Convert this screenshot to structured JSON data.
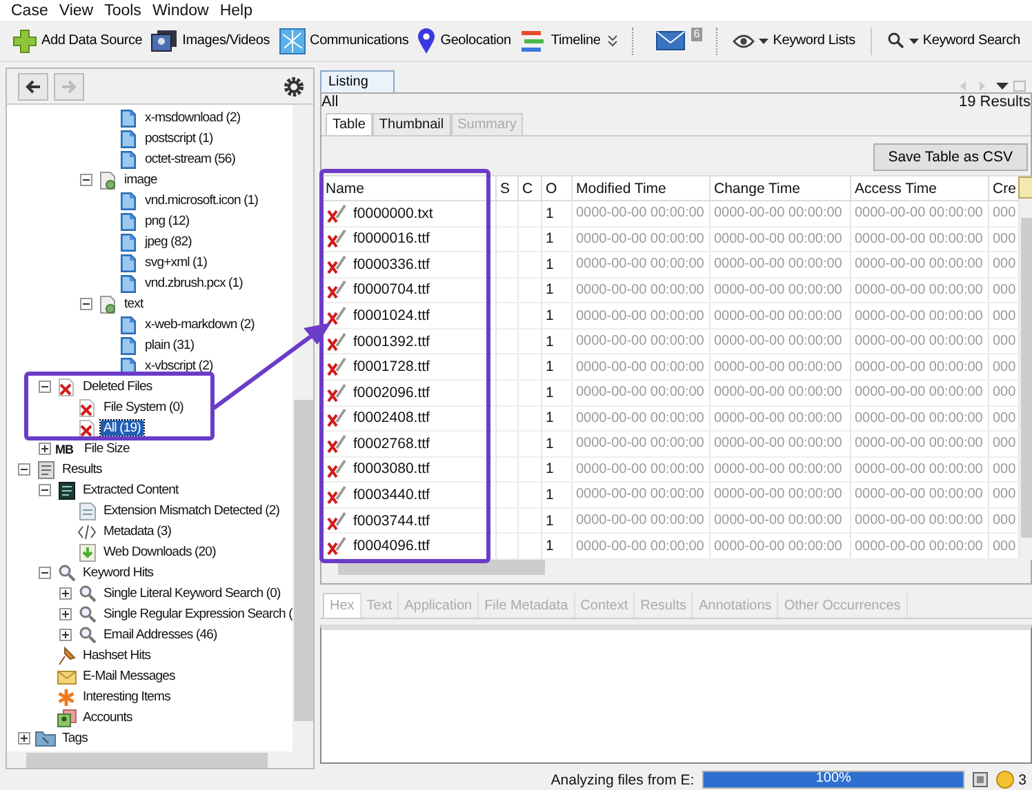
{
  "menu": [
    "Case",
    "View",
    "Tools",
    "Window",
    "Help"
  ],
  "toolbar": [
    {
      "kind": "add",
      "label": "Add Data Source"
    },
    {
      "kind": "images",
      "label": "Images/Videos"
    },
    {
      "kind": "comms",
      "label": "Communications"
    },
    {
      "kind": "geo",
      "label": "Geolocation"
    },
    {
      "kind": "timeline",
      "label": "Timeline"
    },
    {
      "kind": "more"
    },
    {
      "kind": "mail",
      "badge": "6"
    },
    {
      "kind": "eye",
      "label": "Keyword Lists"
    },
    {
      "kind": "search",
      "label": "Keyword Search"
    }
  ],
  "tree": [
    {
      "kind": "hidden",
      "children": [
        {
          "kind": "hidden",
          "children": [
            {
              "kind": "hidden",
              "children": [
                {
                  "kind": "hidden",
                  "children": [
                    {
                      "label": "x-msdownload (2)",
                      "kind": "doc",
                      "selected": false
                    },
                    {
                      "label": "postscript (1)",
                      "kind": "doc",
                      "selected": false
                    },
                    {
                      "label": "octet-stream (56)",
                      "kind": "doc",
                      "selected": false
                    }
                  ]
                },
                {
                  "label": "image",
                  "kind": "mime",
                  "expanded": true,
                  "selected": false,
                  "children": [
                    {
                      "label": "vnd.microsoft.icon (1)",
                      "kind": "doc",
                      "selected": false
                    },
                    {
                      "label": "png (12)",
                      "kind": "doc",
                      "selected": false
                    },
                    {
                      "label": "jpeg (82)",
                      "kind": "doc",
                      "selected": false
                    },
                    {
                      "label": "svg+xml (1)",
                      "kind": "doc",
                      "selected": false
                    },
                    {
                      "label": "vnd.zbrush.pcx (1)",
                      "kind": "doc",
                      "selected": false
                    }
                  ]
                },
                {
                  "label": "text",
                  "kind": "mime",
                  "expanded": true,
                  "selected": false,
                  "children": [
                    {
                      "label": "x-web-markdown (2)",
                      "kind": "doc",
                      "selected": false
                    },
                    {
                      "label": "plain (31)",
                      "kind": "doc",
                      "selected": false
                    },
                    {
                      "label": "x-vbscript (2)",
                      "kind": "doc",
                      "selected": false
                    }
                  ]
                }
              ]
            }
          ]
        },
        {
          "label": "Deleted Files",
          "kind": "deleted",
          "expanded": true,
          "selected": false,
          "children": [
            {
              "label": "File System (0)",
              "kind": "deleted",
              "selected": false
            },
            {
              "label": "All (19)",
              "kind": "deleted",
              "selected": true
            }
          ]
        },
        {
          "label": "File Size",
          "icon_text": "MB",
          "expanded": false,
          "selected": false
        }
      ]
    },
    {
      "label": "Results",
      "kind": "results",
      "expanded": true,
      "selected": false,
      "children": [
        {
          "label": "Extracted Content",
          "kind": "extracted",
          "expanded": true,
          "selected": false,
          "children": [
            {
              "label": "Extension Mismatch Detected (2)",
              "kind": "mismatch",
              "selected": false
            },
            {
              "label": "Metadata (3)",
              "kind": "metadata",
              "selected": false
            },
            {
              "label": "Web Downloads (20)",
              "kind": "download",
              "selected": false
            }
          ]
        },
        {
          "label": "Keyword Hits",
          "kind": "search",
          "expanded": true,
          "selected": false,
          "children": [
            {
              "label": "Single Literal Keyword Search (0)",
              "kind": "search",
              "expanded": false,
              "selected": false
            },
            {
              "label": "Single Regular Expression Search (",
              "kind": "search",
              "expanded": false,
              "selected": false
            },
            {
              "label": "Email Addresses (46)",
              "kind": "search",
              "expanded": false,
              "selected": false
            }
          ]
        },
        {
          "label": "Hashset Hits",
          "kind": "hashset",
          "selected": false
        },
        {
          "label": "E-Mail Messages",
          "kind": "email",
          "selected": false
        },
        {
          "label": "Interesting Items",
          "kind": "interesting",
          "selected": false
        },
        {
          "label": "Accounts",
          "kind": "accounts",
          "selected": false
        }
      ]
    },
    {
      "label": "Tags",
      "kind": "tags",
      "expanded": false,
      "selected": false
    }
  ],
  "listing": {
    "tabs": [
      {
        "label": "Listing",
        "selected": true
      }
    ],
    "path": "All",
    "result_count": "19 Results",
    "view_tabs": [
      {
        "label": "Table",
        "selected": true,
        "disabled": false
      },
      {
        "label": "Thumbnail",
        "selected": false,
        "disabled": false
      },
      {
        "label": "Summary",
        "selected": false,
        "disabled": true
      }
    ],
    "save_button": "Save Table as CSV",
    "columns": [
      "Name",
      "S",
      "C",
      "O",
      "Modified Time",
      "Change Time",
      "Access Time",
      "Cre"
    ],
    "rows": [
      {
        "name": "f0000000.txt",
        "o": "1",
        "modified": "0000-00-00 00:00:00",
        "change": "0000-00-00 00:00:00",
        "access": "0000-00-00 00:00:00",
        "column_8": "000"
      },
      {
        "name": "f0000016.ttf",
        "o": "1",
        "modified": "0000-00-00 00:00:00",
        "change": "0000-00-00 00:00:00",
        "access": "0000-00-00 00:00:00",
        "column_8": "000"
      },
      {
        "name": "f0000336.ttf",
        "o": "1",
        "modified": "0000-00-00 00:00:00",
        "change": "0000-00-00 00:00:00",
        "access": "0000-00-00 00:00:00",
        "column_8": "000"
      },
      {
        "name": "f0000704.ttf",
        "o": "1",
        "modified": "0000-00-00 00:00:00",
        "change": "0000-00-00 00:00:00",
        "access": "0000-00-00 00:00:00",
        "column_8": "000"
      },
      {
        "name": "f0001024.ttf",
        "o": "1",
        "modified": "0000-00-00 00:00:00",
        "change": "0000-00-00 00:00:00",
        "access": "0000-00-00 00:00:00",
        "column_8": "000"
      },
      {
        "name": "f0001392.ttf",
        "o": "1",
        "modified": "0000-00-00 00:00:00",
        "change": "0000-00-00 00:00:00",
        "access": "0000-00-00 00:00:00",
        "column_8": "000"
      },
      {
        "name": "f0001728.ttf",
        "o": "1",
        "modified": "0000-00-00 00:00:00",
        "change": "0000-00-00 00:00:00",
        "access": "0000-00-00 00:00:00",
        "column_8": "000"
      },
      {
        "name": "f0002096.ttf",
        "o": "1",
        "modified": "0000-00-00 00:00:00",
        "change": "0000-00-00 00:00:00",
        "access": "0000-00-00 00:00:00",
        "column_8": "000"
      },
      {
        "name": "f0002408.ttf",
        "o": "1",
        "modified": "0000-00-00 00:00:00",
        "change": "0000-00-00 00:00:00",
        "access": "0000-00-00 00:00:00",
        "column_8": "000"
      },
      {
        "name": "f0002768.ttf",
        "o": "1",
        "modified": "0000-00-00 00:00:00",
        "change": "0000-00-00 00:00:00",
        "access": "0000-00-00 00:00:00",
        "column_8": "000"
      },
      {
        "name": "f0003080.ttf",
        "o": "1",
        "modified": "0000-00-00 00:00:00",
        "change": "0000-00-00 00:00:00",
        "access": "0000-00-00 00:00:00",
        "column_8": "000"
      },
      {
        "name": "f0003440.ttf",
        "o": "1",
        "modified": "0000-00-00 00:00:00",
        "change": "0000-00-00 00:00:00",
        "access": "0000-00-00 00:00:00",
        "column_8": "000"
      },
      {
        "name": "f0003744.ttf",
        "o": "1",
        "modified": "0000-00-00 00:00:00",
        "change": "0000-00-00 00:00:00",
        "access": "0000-00-00 00:00:00",
        "column_8": "000"
      },
      {
        "name": "f0004096.ttf",
        "o": "1",
        "modified": "0000-00-00 00:00:00",
        "change": "0000-00-00 00:00:00",
        "access": "0000-00-00 00:00:00",
        "column_8": "000"
      }
    ]
  },
  "viewer": {
    "tabs": [
      {
        "label": "Hex",
        "selected": true,
        "disabled": true
      },
      {
        "label": "Text",
        "selected": false,
        "disabled": true
      },
      {
        "label": "Application",
        "selected": false,
        "disabled": true
      },
      {
        "label": "File Metadata",
        "selected": false,
        "disabled": true
      },
      {
        "label": "Context",
        "selected": false,
        "disabled": true
      },
      {
        "label": "Results",
        "selected": false,
        "disabled": true
      },
      {
        "label": "Annotations",
        "selected": false,
        "disabled": true
      },
      {
        "label": "Other Occurrences",
        "selected": false,
        "disabled": true
      }
    ]
  },
  "status_bar": {
    "message": "Analyzing files from E:",
    "progress": {
      "level": 1,
      "reading": "100%"
    },
    "notifications": "3"
  }
}
